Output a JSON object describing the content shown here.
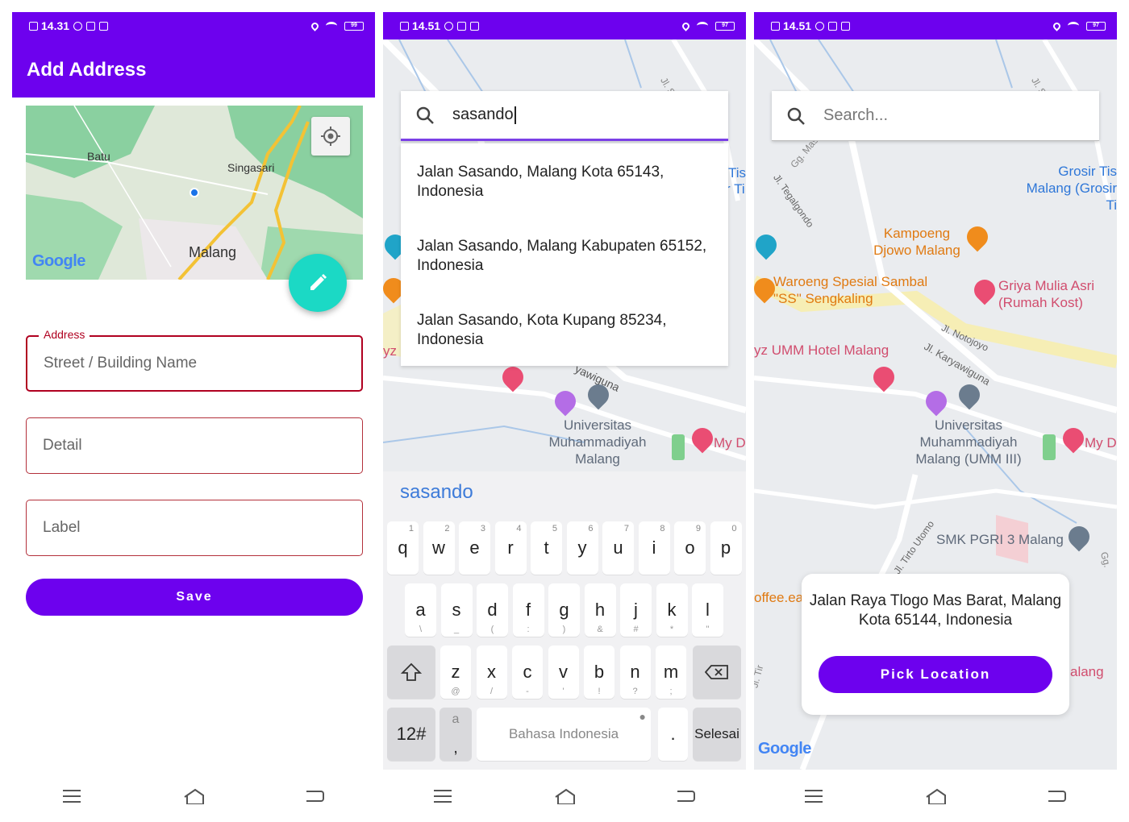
{
  "screens": [
    {
      "status": {
        "time": "14.31",
        "battery": "99"
      },
      "appbar_title": "Add Address",
      "minimap": {
        "labels": [
          "Batu",
          "Singasari",
          "Malang"
        ],
        "google": "Google"
      },
      "fields": [
        {
          "float_label": "Address",
          "placeholder": "Street / Building Name"
        },
        {
          "placeholder": "Detail"
        },
        {
          "placeholder": "Label"
        }
      ],
      "save_label": "Save"
    },
    {
      "status": {
        "time": "14.51",
        "battery": "97"
      },
      "search_query": "sasando",
      "suggestions": [
        "Jalan Sasando, Malang Kota 65143, Indonesia",
        "Jalan Sasando, Malang Kabupaten 65152, Indonesia",
        "Jalan Sasando, Kota Kupang 85234, Indonesia"
      ],
      "map_labels": {
        "univ": "Universitas Muhammadiyah Malang",
        "myd": "My D",
        "yz": "yz",
        "grosir": "Tis",
        "grosir2": "r Ti",
        "jl": "Jl. S",
        "yawiguna": "yawiguna"
      },
      "keyboard": {
        "suggestion": "sasando",
        "row1": [
          [
            "q",
            "1"
          ],
          [
            "w",
            "2"
          ],
          [
            "e",
            "3"
          ],
          [
            "r",
            "4"
          ],
          [
            "t",
            "5"
          ],
          [
            "y",
            "6"
          ],
          [
            "u",
            "7"
          ],
          [
            "i",
            "8"
          ],
          [
            "o",
            "9"
          ],
          [
            "p",
            "0"
          ]
        ],
        "row2": [
          [
            "a",
            "\\"
          ],
          [
            "s",
            "_"
          ],
          [
            "d",
            "("
          ],
          [
            "f",
            ":"
          ],
          [
            "g",
            ")"
          ],
          [
            "h",
            "&"
          ],
          [
            "j",
            "#"
          ],
          [
            "k",
            "*"
          ],
          [
            "l",
            "\""
          ]
        ],
        "row3": [
          [
            "z",
            "@"
          ],
          [
            "x",
            "/"
          ],
          [
            "c",
            "-"
          ],
          [
            "v",
            "'"
          ],
          [
            "b",
            "!"
          ],
          [
            "n",
            "?"
          ],
          [
            "m",
            ";"
          ]
        ],
        "numkey": "12#",
        "space": "Bahasa Indonesia",
        "period": ".",
        "done": "Selesai",
        "comma": ","
      }
    },
    {
      "status": {
        "time": "14.51",
        "battery": "97"
      },
      "search_placeholder": "Search...",
      "map_labels": {
        "grosir": "Grosir Tis Malang (Grosir Ti",
        "kampoeng": "Kampoeng Djowo Malang",
        "waroeng": "Waroeng Spesial Sambal \"SS\" Sengkaling",
        "griya": "Griya Mulia Asri (Rumah Kost)",
        "umm_hotel": "yz UMM Hotel Malang",
        "univ": "Universitas Muhammadiyah Malang (UMM III)",
        "myd": "My D",
        "smk": "SMK PGRI 3 Malang",
        "notojoyo": "Jl. Notojoyo",
        "karyawiguna": "Jl. Karyawiguna",
        "tegalgondo": "Jl. Tegalgondo",
        "tirto": "Jl. Tirto Utomo",
        "coffee": "offee.ea",
        "alang": "alang",
        "gg": "Gg. Mas",
        "google": "Google",
        "jl_top": "Jl. S",
        "jl_tir": "Jl. Tir",
        "gg_right": "Gg."
      },
      "card_address": "Jalan Raya Tlogo Mas Barat, Malang Kota 65144, Indonesia",
      "pick_label": "Pick Location"
    }
  ],
  "colors": {
    "primary": "#6d01ee",
    "fab": "#1bd9c5",
    "error": "#b00020"
  }
}
